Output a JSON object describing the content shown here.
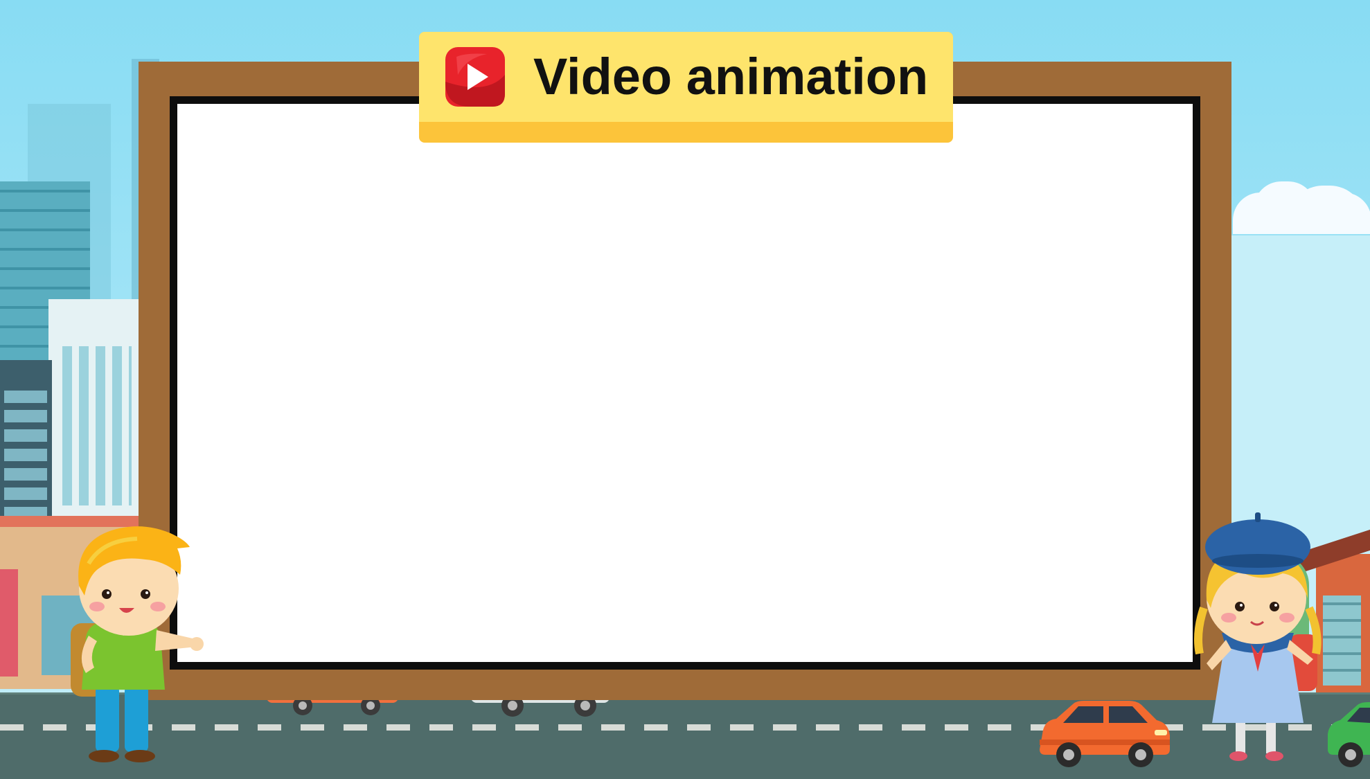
{
  "title": {
    "text": "Video animation",
    "icon": "play-button-icon"
  },
  "colors": {
    "sky": "#88dcf3",
    "board_frame": "#9f6b38",
    "board_border": "#0d0d0d",
    "board_screen": "#ffffff",
    "banner_top": "#fee46c",
    "banner_bottom": "#fcc43a",
    "play_icon": "#e8232b",
    "road": "#4f6c6a"
  },
  "characters": [
    "boy-with-backpack",
    "girl-with-beret"
  ],
  "vehicles": [
    "orange-car",
    "green-car"
  ]
}
